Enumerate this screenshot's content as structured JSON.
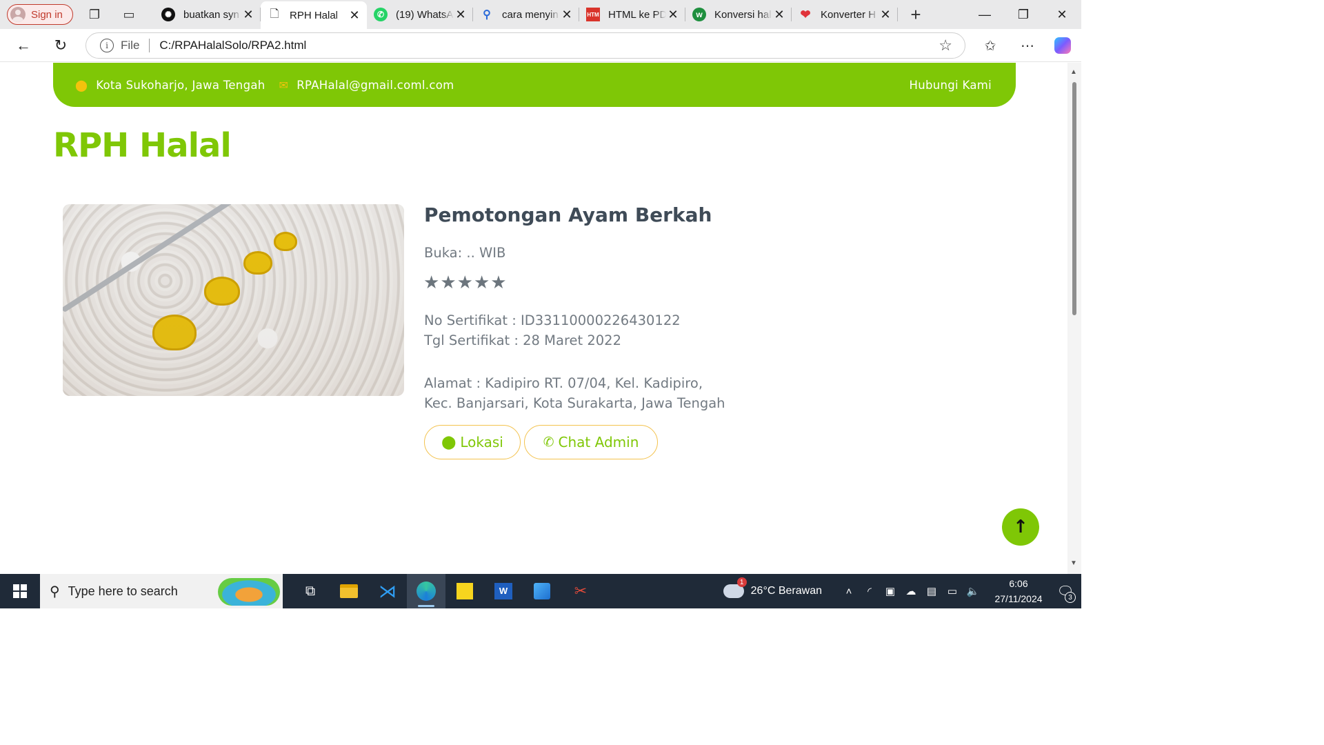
{
  "browser": {
    "sign_in": "Sign in",
    "tabs": [
      {
        "title": "buatkan syn",
        "icon": "openai-icon"
      },
      {
        "title": "RPH Halal",
        "icon": "page-icon"
      },
      {
        "title": "(19) WhatsA",
        "icon": "whatsapp-icon"
      },
      {
        "title": "cara menyin",
        "icon": "search-icon"
      },
      {
        "title": "HTML ke PD",
        "icon": "htmlpdf-icon"
      },
      {
        "title": "Konversi hal",
        "icon": "w-icon"
      },
      {
        "title": "Konverter H",
        "icon": "heart-icon"
      }
    ],
    "address": {
      "scheme_label": "File",
      "url": "C:/RPAHalalSolo/RPA2.html"
    }
  },
  "page": {
    "topbar": {
      "location": "Kota Sukoharjo, Jawa Tengah",
      "email": "RPAHalal@gmail.coml.com",
      "contact": "Hubungi Kami"
    },
    "brand": "RPH Halal",
    "listing": {
      "name": "Pemotongan Ayam Berkah",
      "hours": "Buka: .. WIB",
      "rating": 5,
      "certificate_no": "No Sertifikat : ID33110000226430122",
      "certificate_date": "Tgl Sertifikat : 28 Maret 2022",
      "address": "Alamat : Kadipiro RT. 07/04, Kel. Kadipiro, Kec. Banjarsari, Kota Surakarta, Jawa Tengah",
      "btn_location": "Lokasi",
      "btn_chat": "Chat Admin"
    }
  },
  "taskbar": {
    "search_placeholder": "Type here to search",
    "weather": "26°C  Berawan",
    "weather_badge": "1",
    "time": "6:06",
    "date": "27/11/2024",
    "notifications": "3"
  },
  "colors": {
    "accent": "#7fc706",
    "star": "#6c757d",
    "button_border": "#f3c24d"
  }
}
